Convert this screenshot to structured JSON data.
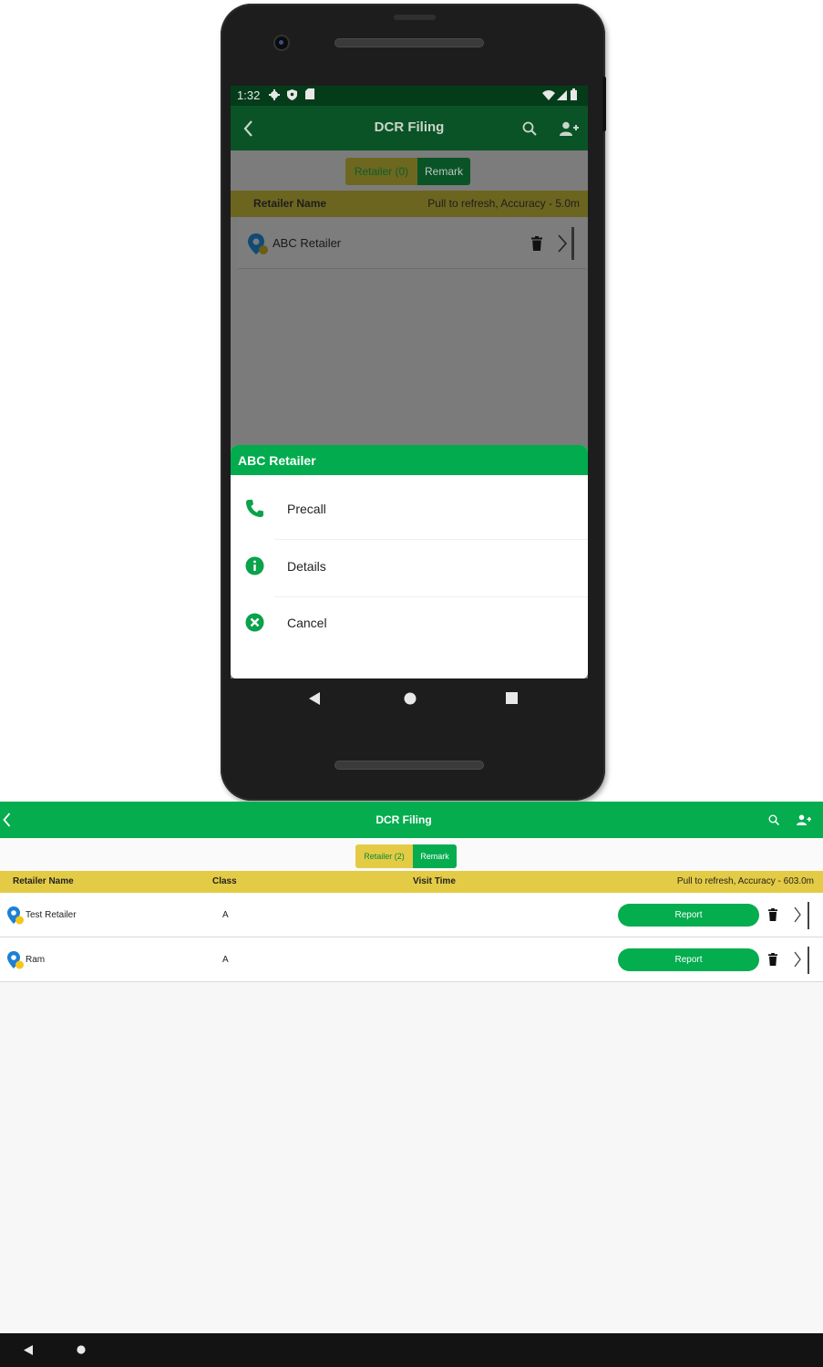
{
  "phone": {
    "status": {
      "time": "1:32"
    },
    "appbar": {
      "title": "DCR Filing"
    },
    "tabs": [
      {
        "label": "Retailer (0)"
      },
      {
        "label": "Remark"
      }
    ],
    "list_header": {
      "name_label": "Retailer Name",
      "info": "Pull to refresh, Accuracy - 5.0m"
    },
    "retailers": [
      {
        "name": "ABC Retailer"
      }
    ],
    "sheet": {
      "title": "ABC Retailer",
      "items": [
        {
          "label": "Precall",
          "icon": "phone-icon"
        },
        {
          "label": "Details",
          "icon": "info-icon"
        },
        {
          "label": "Cancel",
          "icon": "cancel-icon"
        }
      ]
    }
  },
  "tablet": {
    "appbar": {
      "title": "DCR Filing"
    },
    "tabs": [
      {
        "label": "Retailer (2)"
      },
      {
        "label": "Remark"
      }
    ],
    "columns": {
      "name": "Retailer Name",
      "class": "Class",
      "visit_time": "Visit Time",
      "info": "Pull to refresh, Accuracy - 603.0m"
    },
    "rows": [
      {
        "name": "Test Retailer",
        "class": "A",
        "action": "Report"
      },
      {
        "name": "Ram",
        "class": "A",
        "action": "Report"
      }
    ]
  },
  "colors": {
    "primary_green": "#05ad4f",
    "header_yellow": "#e4cb45",
    "pin_blue": "#1e7fd6",
    "pin_yellow": "#f5c518"
  }
}
